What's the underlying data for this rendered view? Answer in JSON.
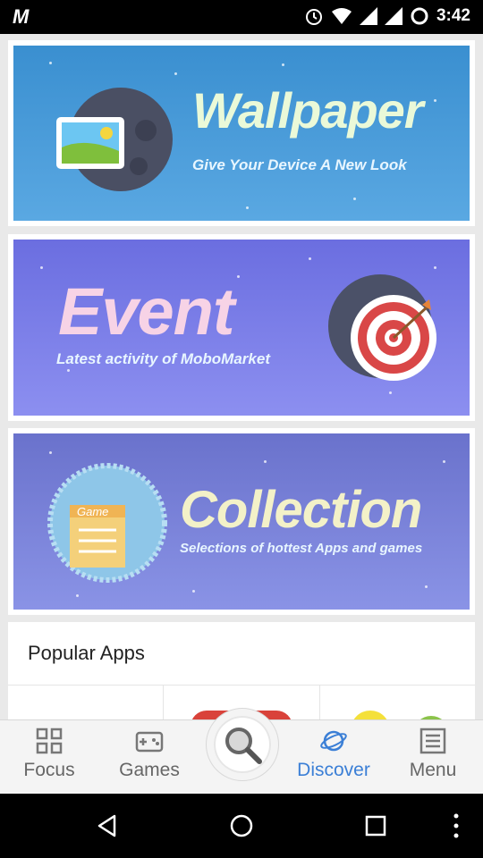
{
  "status_bar": {
    "time": "3:42",
    "notification_icon": "gmail-icon"
  },
  "banners": [
    {
      "title": "Wallpaper",
      "subtitle": "Give Your Device A New Look",
      "colors": {
        "title": "#eaf9d8",
        "bg": "#3a8fd0"
      }
    },
    {
      "title": "Event",
      "subtitle": "Latest activity of MoboMarket",
      "colors": {
        "title": "#f7d3e6",
        "bg": "#6b6ee0"
      }
    },
    {
      "title": "Collection",
      "subtitle": "Selections of hottest Apps and games",
      "badge": "Game",
      "colors": {
        "title": "#f3f1c8",
        "bg": "#6a72cc"
      }
    }
  ],
  "popular": {
    "heading": "Popular Apps"
  },
  "bottom_nav": {
    "items": [
      {
        "label": "Focus",
        "icon": "grid-icon"
      },
      {
        "label": "Games",
        "icon": "gamepad-icon"
      },
      {
        "label": "Discover",
        "icon": "planet-icon",
        "active": true
      },
      {
        "label": "Menu",
        "icon": "list-icon"
      }
    ],
    "center_icon": "search-icon"
  },
  "accent": "#3b7fd6"
}
